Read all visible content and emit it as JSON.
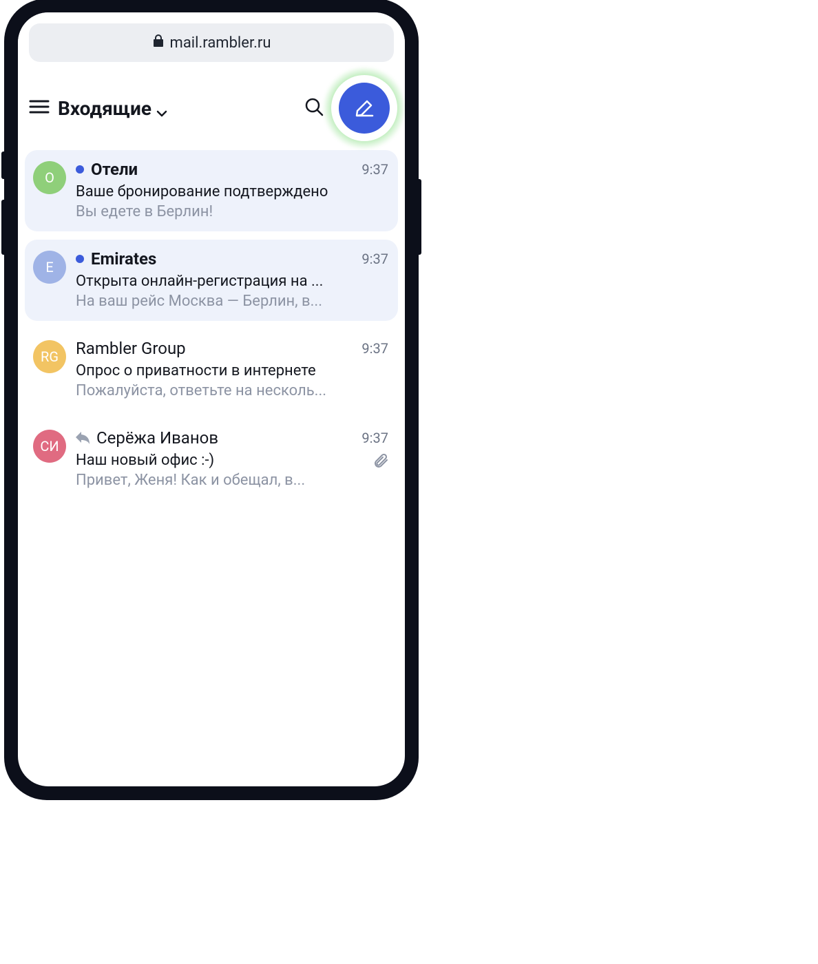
{
  "address_bar": {
    "url": "mail.rambler.ru"
  },
  "toolbar": {
    "folder_label": "Входящие",
    "hamburger_icon": "menu-icon",
    "search_icon": "search-icon",
    "compose_icon": "compose-icon"
  },
  "messages": [
    {
      "avatar_text": "O",
      "avatar_bg": "#8fcf7a",
      "unread": true,
      "has_reply": false,
      "has_attachment": false,
      "sender": "Отели",
      "time": "9:37",
      "subject": "Ваше бронирование подтверждено",
      "preview": "Вы едете в Берлин!"
    },
    {
      "avatar_text": "E",
      "avatar_bg": "#9fb3e6",
      "unread": true,
      "has_reply": false,
      "has_attachment": false,
      "sender": "Emirates",
      "time": "9:37",
      "subject": "Открыта онлайн-регистрация на ...",
      "preview": "На ваш рейс Москва — Берлин, в..."
    },
    {
      "avatar_text": "RG",
      "avatar_bg": "#f2c463",
      "unread": false,
      "has_reply": false,
      "has_attachment": false,
      "sender": "Rambler Group",
      "time": "9:37",
      "subject": "Опрос о приватности в интернете",
      "preview": "Пожалуйста, ответьте на несколь..."
    },
    {
      "avatar_text": "СИ",
      "avatar_bg": "#e06b81",
      "unread": false,
      "has_reply": true,
      "has_attachment": true,
      "sender": "Серёжа Иванов",
      "time": "9:37",
      "subject": "Наш новый офис :-)",
      "preview": "Привет, Женя! Как и обещал, в..."
    }
  ]
}
